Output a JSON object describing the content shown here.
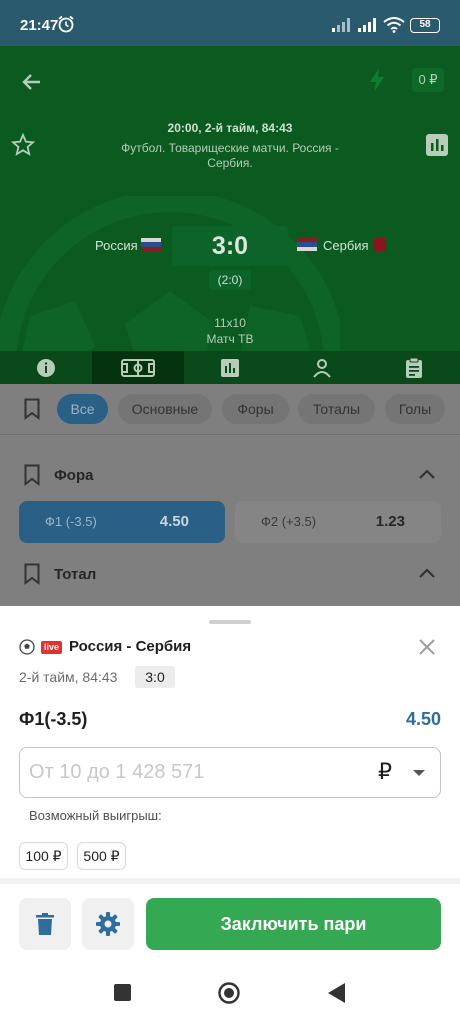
{
  "status_bar": {
    "time": "21:47",
    "battery": "58"
  },
  "header": {
    "balance": "0 ₽",
    "match_time": "20:00, 2-й тайм, 84:43",
    "match_desc": "Футбол. Товарищеские матчи. Россия - Сербия.",
    "team_home": "Россия",
    "team_away": "Сербия",
    "score": "3:0",
    "half_score": "(2:0)",
    "format": "11x10",
    "tv": "Матч ТВ",
    "tabs": [
      "info-icon",
      "field-icon",
      "stats-icon",
      "person-icon",
      "clipboard-icon"
    ]
  },
  "filters": {
    "chips": [
      "Все",
      "Основные",
      "Форы",
      "Тоталы",
      "Голы"
    ],
    "active": "Все"
  },
  "markets": {
    "handicap_title": "Фора",
    "total_title": "Тотал",
    "odds": [
      {
        "label": "Ф1 (-3.5)",
        "value": "4.50"
      },
      {
        "label": "Ф2 (+3.5)",
        "value": "1.23"
      }
    ]
  },
  "bet_slip": {
    "live_label": "live",
    "match": "Россия - Сербия",
    "period": "2-й тайм, 84:43",
    "score": "3:0",
    "bet_name": "Ф1(-3.5)",
    "bet_odd": "4.50",
    "stake_placeholder": "От 10 до 1 428 571",
    "currency": "₽",
    "winnings_label": "Возможный выигрыш:",
    "quick_amounts": [
      "100 ₽",
      "500 ₽"
    ],
    "place_label": "Заключить пари"
  },
  "colors": {
    "header_green": "#0b5b20",
    "accent_blue": "#2f6d9d",
    "place_green": "#34a853",
    "live_red": "#e0332e"
  }
}
